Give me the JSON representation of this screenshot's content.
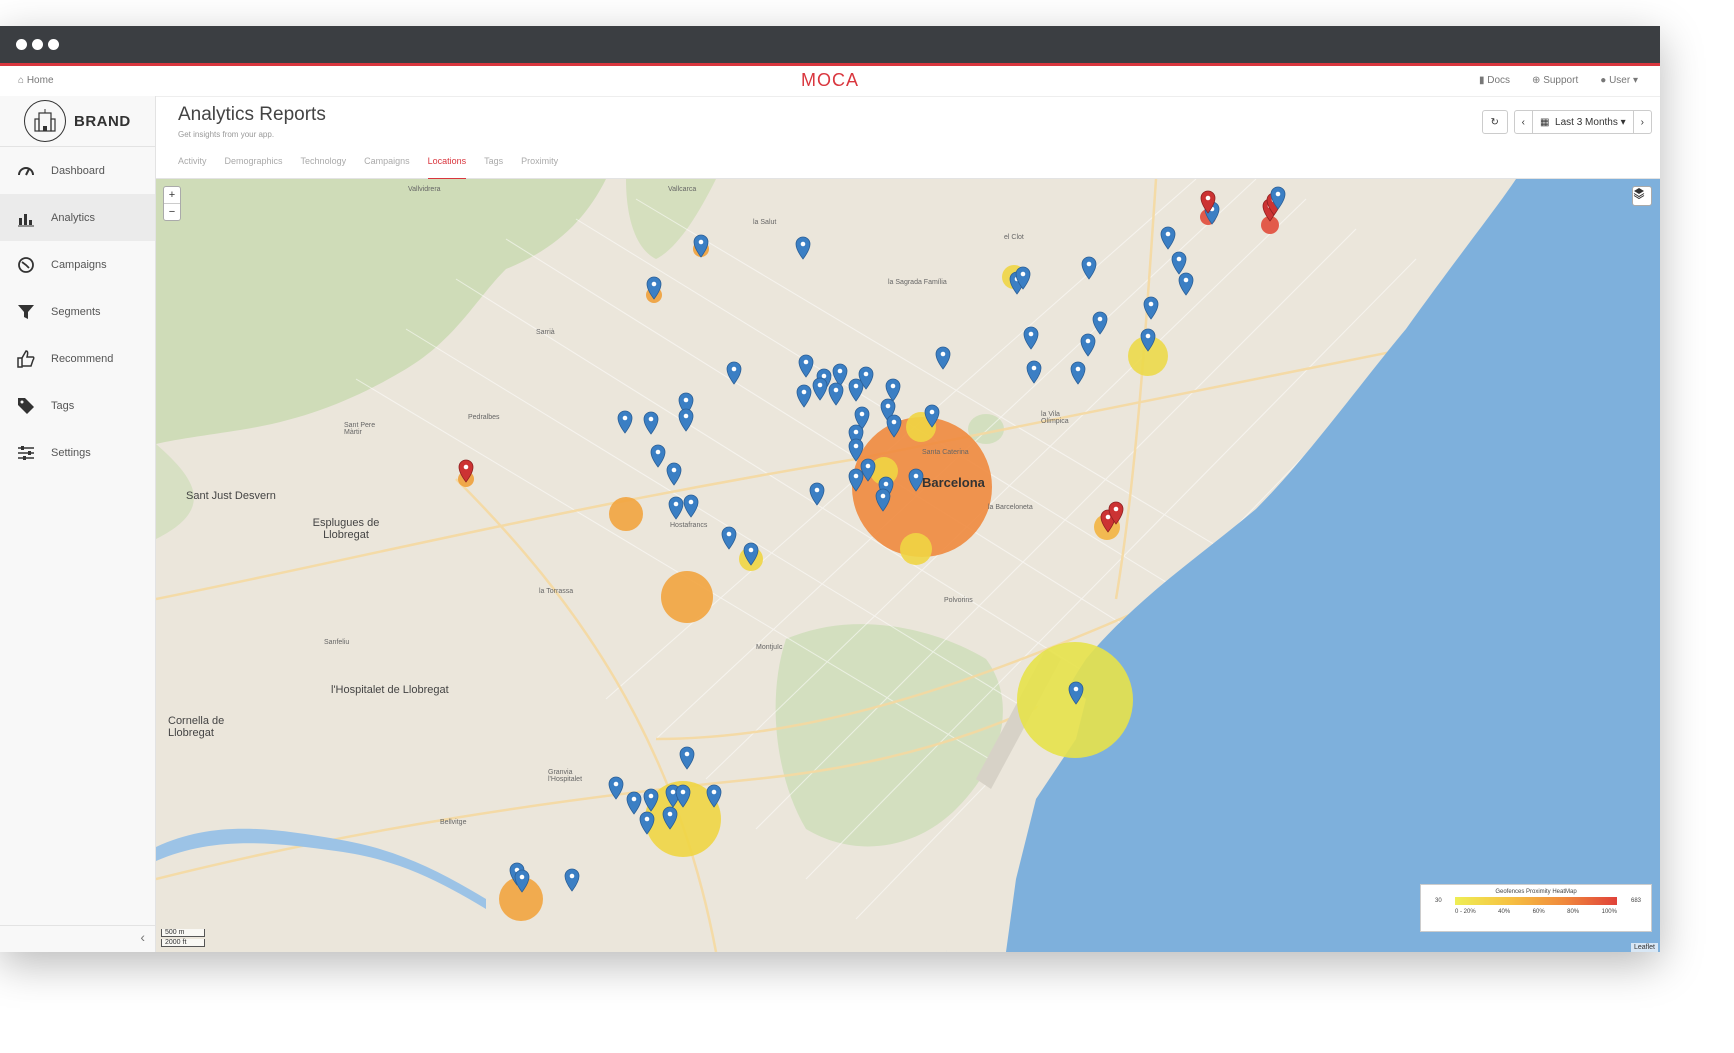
{
  "topnav": {
    "home": "Home",
    "logo": "MOCA",
    "docs": "Docs",
    "support": "Support",
    "user": "User"
  },
  "brand": {
    "name": "BRAND"
  },
  "sidebar": {
    "items": [
      {
        "label": "Dashboard",
        "icon": "gauge-icon"
      },
      {
        "label": "Analytics",
        "icon": "bar-chart-icon"
      },
      {
        "label": "Campaigns",
        "icon": "campaign-icon"
      },
      {
        "label": "Segments",
        "icon": "filter-icon"
      },
      {
        "label": "Recommend",
        "icon": "thumbs-up-icon"
      },
      {
        "label": "Tags",
        "icon": "tag-icon"
      },
      {
        "label": "Settings",
        "icon": "sliders-icon"
      }
    ],
    "active": "Analytics",
    "collapse": "‹"
  },
  "header": {
    "title": "Analytics Reports",
    "subtitle": "Get insights from your app.",
    "range_label": "Last 3 Months"
  },
  "tabs": [
    "Activity",
    "Demographics",
    "Technology",
    "Campaigns",
    "Locations",
    "Tags",
    "Proximity"
  ],
  "active_tab": "Locations",
  "map": {
    "zoom_in": "+",
    "zoom_out": "−",
    "labels": {
      "barcelona": "Barcelona",
      "sant_just": "Sant Just Desvern",
      "esplugues": "Esplugues de Llobregat",
      "hospitalet": "l'Hospitalet de Llobregat",
      "cornella": "Cornella de Llobregat",
      "vallvidrera": "Vallvidrera",
      "sarria": "Sarrià",
      "pedralbes": "Pedralbes",
      "hostafrancs": "Hostafrancs",
      "la_torrassa": "la Torrassa",
      "montjuic": "Montjuïc",
      "sagrada": "la Sagrada Família",
      "santa_caterina": "Santa Caterina",
      "barceloneta": "la Barceloneta",
      "vila_olimpica": "la Vila Olímpica",
      "el_clot": "el Clot",
      "granvia": "Granvia l'Hospitalet",
      "bellvitge": "Bellvitge",
      "sant_pere": "Sant Pere Màrtir",
      "vallcarca": "Vallcarca",
      "la_salut": "la Salut",
      "polvorins": "Polvorins",
      "sanfeliu": "Sanfeliu"
    },
    "scale": [
      "500 m",
      "2000 ft"
    ],
    "attribution": "Leaflet"
  },
  "legend": {
    "title": "Geofences Proximity HeatMap",
    "min": "30",
    "max": "683",
    "ticks": [
      "0 - 20%",
      "40%",
      "60%",
      "80%",
      "100%"
    ]
  },
  "colors": {
    "accent": "#d9363e",
    "water": "#7eb0dc",
    "pin_blue": "#3b7fc4",
    "pin_red": "#cc3333",
    "heat_yellow": "#efe64b",
    "heat_orange": "#f0a03a",
    "heat_dark_orange": "#e8743a"
  }
}
